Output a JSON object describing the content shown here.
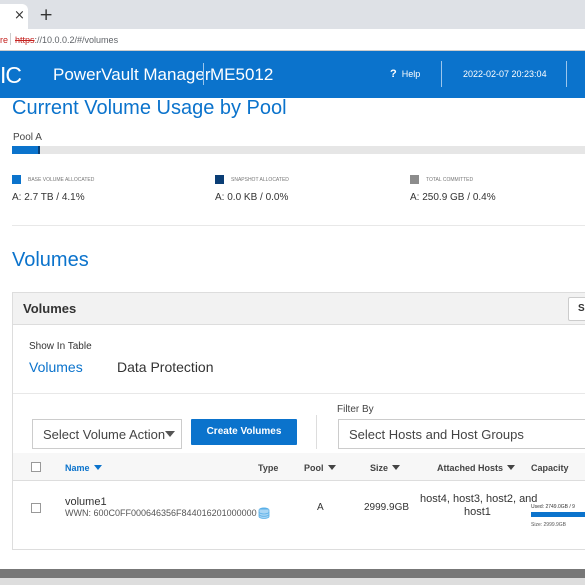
{
  "browser": {
    "tab_close": "×",
    "new_tab": "+",
    "security_label": "re",
    "url_scheme": "https",
    "url_rest": "://10.0.0.2/#/volumes"
  },
  "header": {
    "brand": "IC",
    "product": "PowerVault Manager",
    "model": "ME5012",
    "help_icon": "?",
    "help_label": "Help",
    "datetime": "2022-02-07 20:23:04",
    "background": "#0b73cc"
  },
  "usage": {
    "title": "Current Volume Usage by Pool",
    "pool_name": "Pool A",
    "pool_used_fraction": 0.045,
    "legend": [
      {
        "label": "BASE VOLUME ALLOCATED",
        "value": "A: 2.7 TB / 4.1%",
        "color": "#0b73cc"
      },
      {
        "label": "SNAPSHOT ALLOCATED",
        "value": "A: 0.0 KB / 0.0%",
        "color": "#0a3e75"
      },
      {
        "label": "TOTAL COMMITTED",
        "value": "A: 250.9 GB / 0.4%",
        "color": "#8c8c8c"
      }
    ]
  },
  "volumes": {
    "title": "Volumes",
    "panel_title": "Volumes",
    "panel_button": "Se",
    "show_in_table": "Show In Table",
    "tabs": [
      "Volumes",
      "Data Protection"
    ],
    "filter_by": "Filter By",
    "action_select": "Select Volume Action",
    "create_button": "Create Volumes",
    "host_select": "Select Hosts and Host Groups",
    "columns": {
      "name": "Name",
      "type": "Type",
      "pool": "Pool",
      "size": "Size",
      "hosts": "Attached Hosts",
      "capacity": "Capacity"
    },
    "rows": [
      {
        "name": "volume1",
        "wwn": "WWN: 600C0FF000646356F844016201000000",
        "type_icon": "disk-stack-icon",
        "pool": "A",
        "size": "2999.9GB",
        "hosts_line1": "host4, host3, host2, and",
        "hosts_line2": "host1",
        "cap_used_label": "Used: 2749.0GB / 9",
        "cap_size_label": "Size: 2999.9GB",
        "cap_used_fraction": 0.916
      }
    ]
  }
}
